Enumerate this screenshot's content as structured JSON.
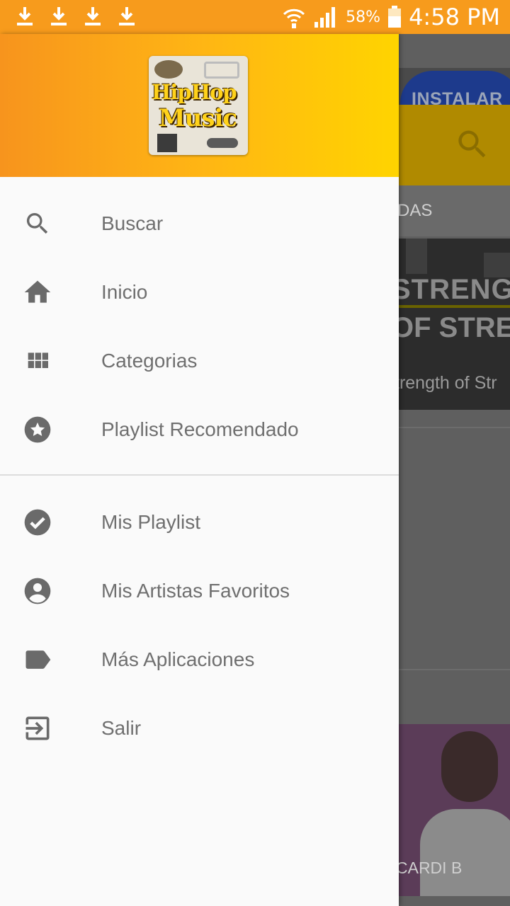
{
  "status_bar": {
    "downloads": [
      "download-icon",
      "download-icon",
      "download-icon",
      "download-icon"
    ],
    "battery": "58%",
    "time": "4:58 PM"
  },
  "background": {
    "install_label": "INSTALAR",
    "tab_label": "DAS",
    "card_title_1": "STRENG",
    "card_title_2": "OF STRE",
    "card_caption": "trength of Str",
    "artist_label": "CARDI B"
  },
  "drawer": {
    "header": {
      "logo_line1": "HipHop",
      "logo_line2": "Music"
    },
    "menu_primary": [
      {
        "label": "Buscar",
        "icon": "search-icon"
      },
      {
        "label": "Inicio",
        "icon": "home-icon"
      },
      {
        "label": "Categorias",
        "icon": "grid-icon"
      },
      {
        "label": "Playlist Recomendado",
        "icon": "star-circle-icon"
      }
    ],
    "menu_secondary": [
      {
        "label": "Mis Playlist",
        "icon": "check-circle-icon"
      },
      {
        "label": "Mis Artistas Favoritos",
        "icon": "account-circle-icon"
      },
      {
        "label": "Más Aplicaciones",
        "icon": "label-icon"
      },
      {
        "label": "Salir",
        "icon": "exit-icon"
      }
    ]
  },
  "colors": {
    "status_bar": "#f79b1c",
    "header_start": "#f7941d",
    "header_end": "#ffd400",
    "icon_gray": "#6a6a6a",
    "text_gray": "#6f6f6f"
  }
}
